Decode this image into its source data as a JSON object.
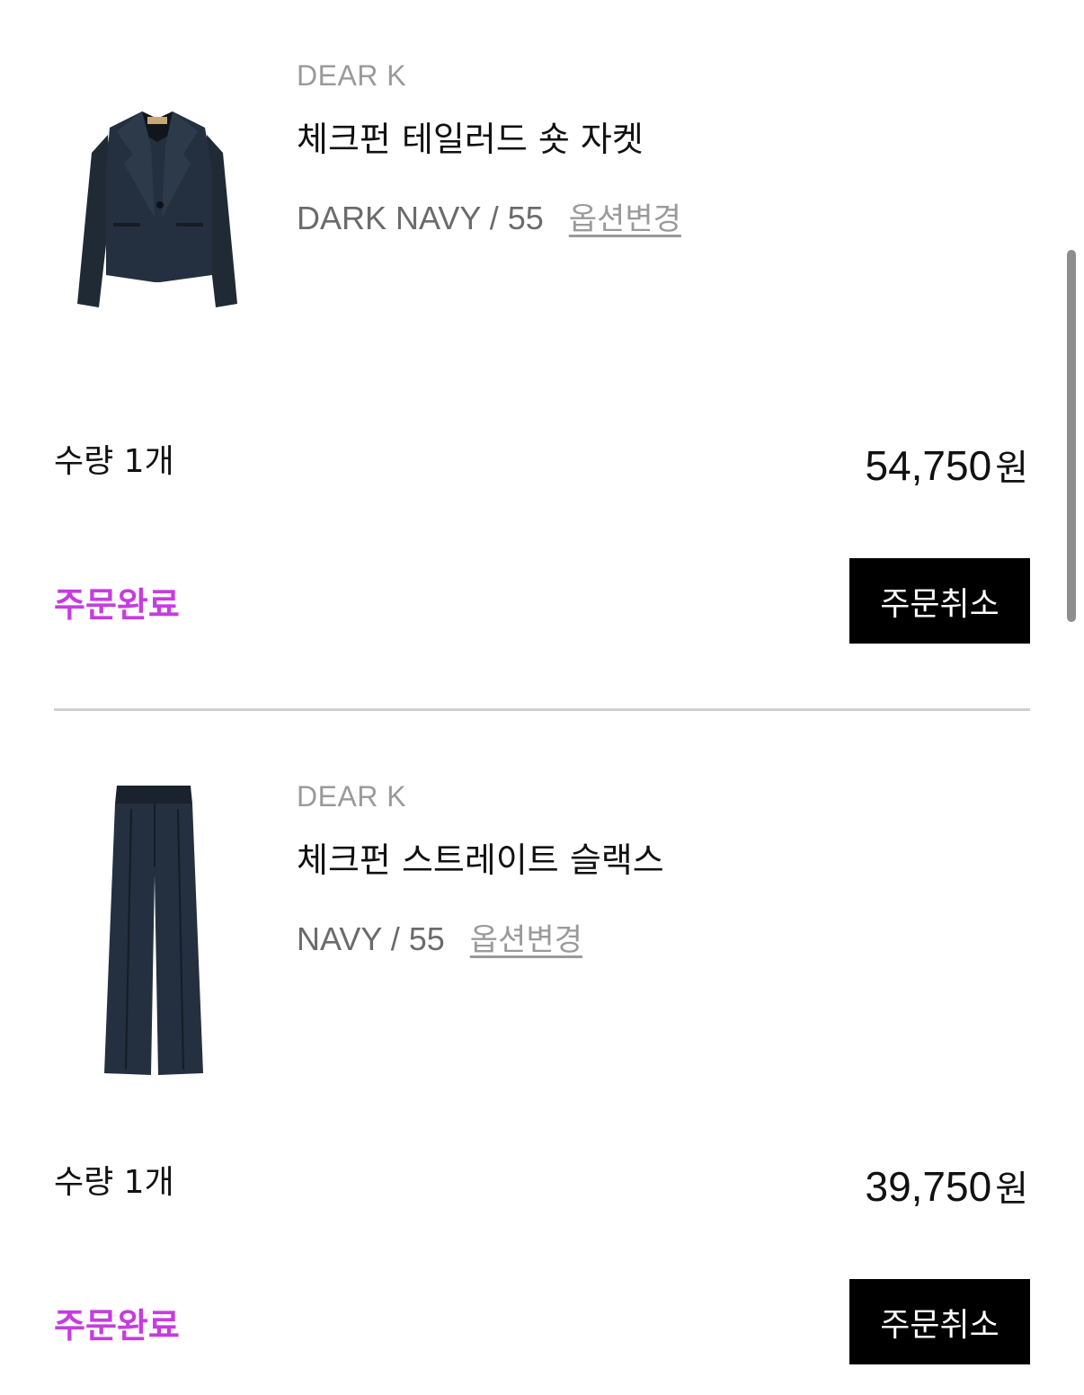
{
  "orders": [
    {
      "brand": "DEAR K",
      "product_name": "체크펀 테일러드 숏 자켓",
      "option": "DARK NAVY / 55",
      "option_change_label": "옵션변경",
      "quantity_label": "수량 1개",
      "price": "54,750",
      "currency": "원",
      "status": "주문완료",
      "cancel_label": "주문취소",
      "image_icon": "jacket-image"
    },
    {
      "brand": "DEAR K",
      "product_name": "체크펀 스트레이트 슬랙스",
      "option": "NAVY / 55",
      "option_change_label": "옵션변경",
      "quantity_label": "수량 1개",
      "price": "39,750",
      "currency": "원",
      "status": "주문완료",
      "cancel_label": "주문취소",
      "image_icon": "slacks-image"
    }
  ],
  "colors": {
    "status": "#c63ce0",
    "button_bg": "#000000",
    "button_text": "#ffffff",
    "product_navy": "#1f2a35"
  }
}
